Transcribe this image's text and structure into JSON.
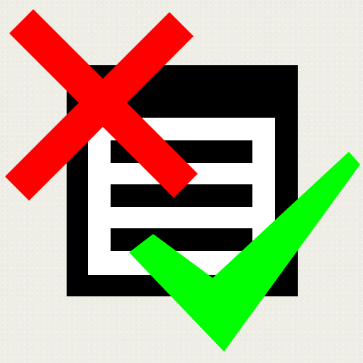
{
  "icon": {
    "name": "document-review-icon",
    "parts": {
      "document": "document-list-icon",
      "reject_mark": "red-x-icon",
      "accept_mark": "green-checkmark-icon"
    }
  },
  "colors": {
    "background": "#efeee6",
    "document_frame": "#000000",
    "document_page": "#ffffff",
    "document_lines": "#000000",
    "reject_mark": "#ff0000",
    "accept_mark": "#00ff00"
  }
}
